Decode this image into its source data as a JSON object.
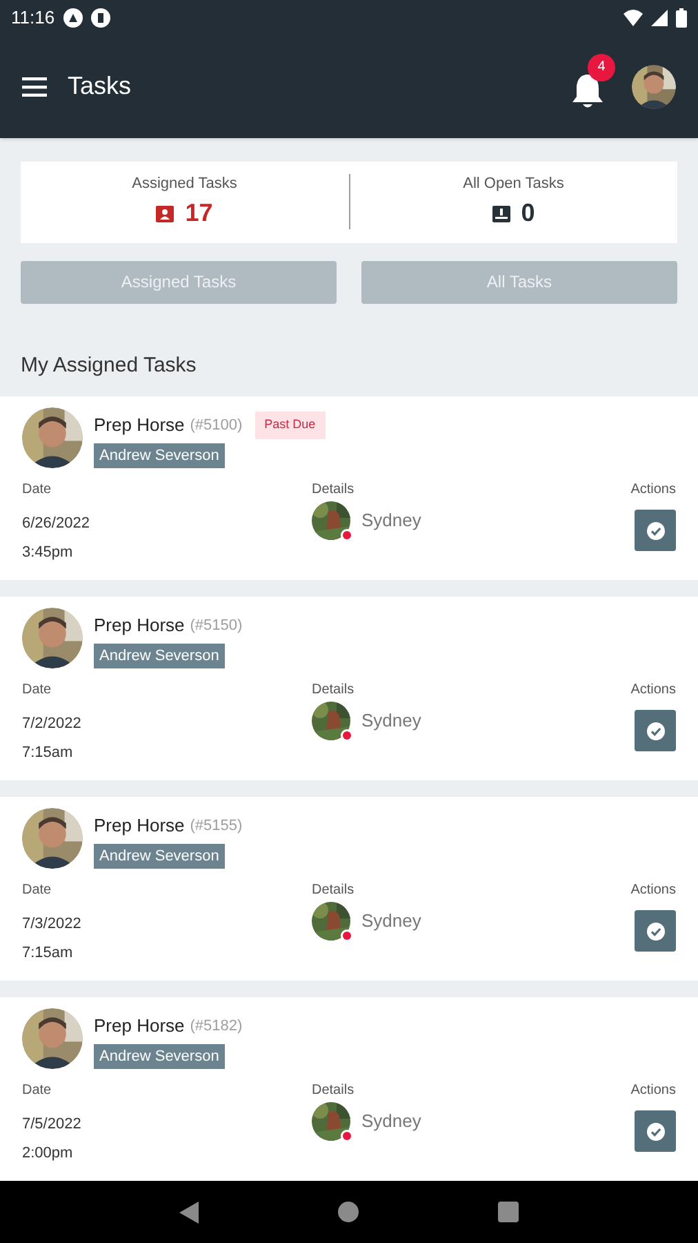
{
  "status_bar": {
    "time": "11:16"
  },
  "app_bar": {
    "title": "Tasks",
    "notification_count": "4"
  },
  "summary": [
    {
      "kind": "assigned",
      "label": "Assigned Tasks",
      "count": "17"
    },
    {
      "kind": "open",
      "label": "All Open Tasks",
      "count": "0"
    }
  ],
  "filter_buttons": [
    {
      "label": "Assigned Tasks",
      "disabled": true
    },
    {
      "label": "All Tasks",
      "disabled": true
    }
  ],
  "section_title": "My Assigned Tasks",
  "tasks": [
    {
      "title": "Prep Horse",
      "number": "(#5100)",
      "badge": "Past Due",
      "assignee": "Andrew Severson",
      "date_label": "Date",
      "date": "6/26/2022",
      "time": "3:45pm",
      "details_label": "Details",
      "horse": "Sydney",
      "actions_label": "Actions"
    },
    {
      "title": "Prep Horse",
      "number": "(#5150)",
      "assignee": "Andrew Severson",
      "date_label": "Date",
      "date": "7/2/2022",
      "time": "7:15am",
      "details_label": "Details",
      "horse": "Sydney",
      "actions_label": "Actions"
    },
    {
      "title": "Prep Horse",
      "number": "(#5155)",
      "assignee": "Andrew Severson",
      "date_label": "Date",
      "date": "7/3/2022",
      "time": "7:15am",
      "details_label": "Details",
      "horse": "Sydney",
      "actions_label": "Actions"
    },
    {
      "title": "Prep Horse",
      "number": "(#5182)",
      "assignee": "Andrew Severson",
      "date_label": "Date",
      "date": "7/5/2022",
      "time": "2:00pm",
      "details_label": "Details",
      "horse": "Sydney",
      "actions_label": "Actions"
    }
  ]
}
